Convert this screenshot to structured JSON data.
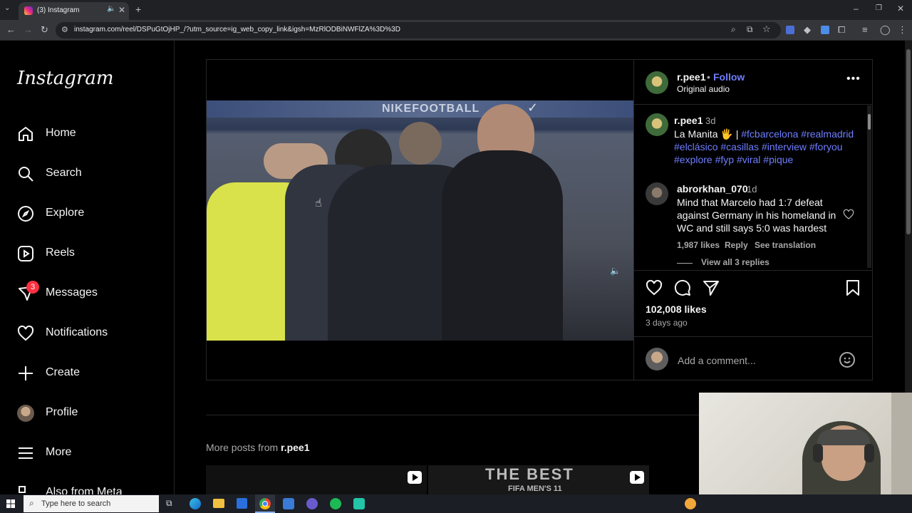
{
  "browser": {
    "tab_title": "(3) Instagram",
    "url": "instagram.com/reel/DSPuGtOjHP_/?utm_source=ig_web_copy_link&igsh=MzRlODBiNWFlZA%3D%3D"
  },
  "sidebar": {
    "logo": "Instagram",
    "items": [
      {
        "label": "Home",
        "icon": "home-icon"
      },
      {
        "label": "Search",
        "icon": "search-icon"
      },
      {
        "label": "Explore",
        "icon": "compass-icon"
      },
      {
        "label": "Reels",
        "icon": "reels-icon"
      },
      {
        "label": "Messages",
        "icon": "messages-icon",
        "badge": "3"
      },
      {
        "label": "Notifications",
        "icon": "heart-icon"
      },
      {
        "label": "Create",
        "icon": "plus-icon"
      },
      {
        "label": "Profile",
        "icon": "avatar"
      },
      {
        "label": "More",
        "icon": "menu-icon"
      },
      {
        "label": "Also from Meta",
        "icon": "meta-icon"
      }
    ]
  },
  "post": {
    "username": "r.pee1",
    "follow_label": "Follow",
    "audio": "Original audio",
    "caption_user": "r.pee1",
    "caption_time": "3d",
    "caption_text": "La Manita 🖐 |",
    "hashtags_line1": "#fcbarcelona #realmadrid",
    "hashtags_line2": "#elclásico #casillas #interview #foryou",
    "hashtags_line3": "#explore #fyp #viral #pique",
    "comment": {
      "user": "abrorkhan_070",
      "time": "1d",
      "text": "Mind that Marcelo had 1:7 defeat against Germany in his homeland in WC and still says 5:0 was hardest",
      "likes": "1,987 likes",
      "reply": "Reply",
      "translate": "See translation",
      "view_replies": "View all 3 replies"
    },
    "likes": "102,008 likes",
    "posted": "3 days ago",
    "add_comment_placeholder": "Add a comment...",
    "video_banner": "NIKEFOOTBALL"
  },
  "more_posts": {
    "prefix": "More posts from",
    "user": "r.pee1",
    "thumb_text_1": "THE BEST",
    "thumb_text_2": "FIFA MEN'S 11"
  },
  "taskbar": {
    "search_placeholder": "Type here to search"
  },
  "colors": {
    "accent": "#6f7eff",
    "badge": "#ff3040",
    "background": "#000000"
  }
}
